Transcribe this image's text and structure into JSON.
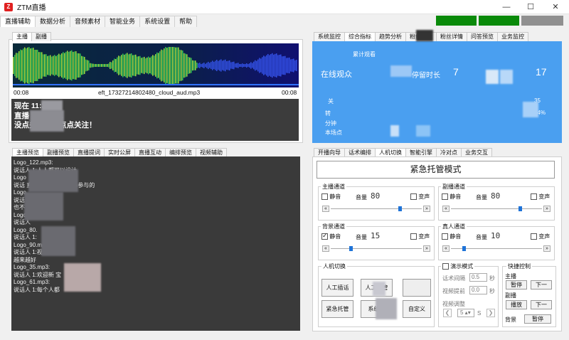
{
  "window": {
    "title": "ZTM直播",
    "icon": "app-logo-icon",
    "min": "—",
    "max": "☐",
    "close": "✕"
  },
  "menu": [
    "直播辅助",
    "数据分析",
    "音频素材",
    "智能业务",
    "系统设置",
    "帮助"
  ],
  "status_colors": [
    "#0a8a0a",
    "#0a8a0a",
    "#909090"
  ],
  "player": {
    "tabs": [
      "主播",
      "副播"
    ],
    "time_left": "00:08",
    "filename": "eft_17327214802480_cloud_aud.mp3",
    "time_right": "00:08",
    "script_lines": [
      "现在        11:31,",
      "直播          拉宝宝们,",
      "没点关注的，点点关注！"
    ]
  },
  "log": {
    "tabs": [
      "主播预览",
      "副播预览",
      "直播提词",
      "实时公屏",
      "直播互动",
      "编排预览",
      "视频辅助"
    ],
    "lines": [
      "Logo_122.mp3:",
      "说话人 1:人人都可以设计",
      "Logo",
      "说话         直播间是一颗小心心参与的",
      "Logo",
      "说话          家等",
      "也不",
      "Logo_6",
      "说话人",
      "Logo_80.",
      "说话人 1:",
      "Logo_90.mp3",
      "说话人 1:视",
      "越来越好",
      "Logo_35.mp3:",
      "说话人 1:欢迎新              宝",
      "Logo_61.mp3:",
      "说话人 1:每个人都"
    ]
  },
  "stats": {
    "tabs": [
      "系统监控",
      "综合指标",
      "趋势分析",
      "粉丝画像",
      "粉丝详情",
      "问答预览",
      "业务监控"
    ],
    "online_label": "在线观众",
    "cumulative_label": "累计观看",
    "stay_label": "停留时长",
    "stay_value": "7",
    "online_value": "17",
    "row_labels": [
      "关",
      "转",
      "分钟",
      "本场点"
    ],
    "percent": "04%",
    "number": "35"
  },
  "control": {
    "tabs": [
      "开播向导",
      "话术编排",
      "人机切换",
      "智能引擎",
      "冷对点",
      "业务交互"
    ],
    "emergency_title": "紧急托管模式",
    "channels": [
      {
        "title": "主播通道",
        "mute": "静音",
        "mute_checked": false,
        "volume_label": "音量",
        "volume": "80",
        "loop": "变声",
        "loop_checked": false,
        "level": 0.76
      },
      {
        "title": "副播通道",
        "mute": "静音",
        "mute_checked": false,
        "volume_label": "音量",
        "volume": "80",
        "loop": "变声",
        "loop_checked": false,
        "level": 0.76
      },
      {
        "title": "背景通道",
        "mute": "静音",
        "mute_checked": true,
        "volume_label": "音量",
        "volume": "15",
        "loop": "变声",
        "loop_checked": false,
        "level": 0.22
      },
      {
        "title": "真人通道",
        "mute": "静音",
        "mute_checked": false,
        "volume_label": "音量",
        "volume": "10",
        "loop": "变声",
        "loop_checked": false,
        "level": 0.14
      }
    ],
    "switch": {
      "title": "人机切换",
      "buttons": [
        "人工插话",
        "人工接管",
        "紧急托管",
        "系统托",
        "自定义"
      ]
    },
    "demo": {
      "title": "演示模式",
      "checked": false,
      "rows": [
        {
          "label": "话术间隔",
          "value": "0.5",
          "unit": "秒"
        },
        {
          "label": "视频提前",
          "value": "0.0",
          "unit": "秒"
        },
        {
          "label": "视频调整",
          "value": "5",
          "unit": "S"
        }
      ]
    },
    "shortcut": {
      "title": "快捷控制",
      "main_label": "主播",
      "pause": "暂停",
      "next": "下一",
      "sub_label": "副播",
      "play": "播放",
      "bg_label": "背景",
      "bg_pause": "暂停"
    }
  }
}
